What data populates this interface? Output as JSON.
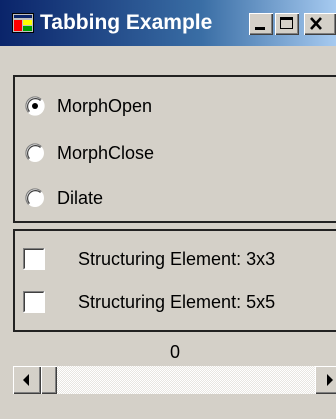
{
  "window": {
    "title": "Tabbing Example",
    "titlebar_colors": {
      "start": "#0a246a",
      "end": "#a6caf0"
    },
    "controls": [
      {
        "name": "minimize",
        "icon": "minimize-icon"
      },
      {
        "name": "maximize",
        "icon": "maximize-icon"
      },
      {
        "name": "close",
        "icon": "close-icon"
      }
    ]
  },
  "morph_group": {
    "options": [
      {
        "label": "MorphOpen",
        "selected": true
      },
      {
        "label": "MorphClose",
        "selected": false
      },
      {
        "label": "Dilate",
        "selected": false
      }
    ]
  },
  "structuring_group": {
    "options": [
      {
        "label": "Structuring Element: 3x3",
        "checked": false
      },
      {
        "label": "Structuring Element: 5x5",
        "checked": false
      }
    ]
  },
  "slider": {
    "value": "0",
    "position_fraction": 0
  }
}
